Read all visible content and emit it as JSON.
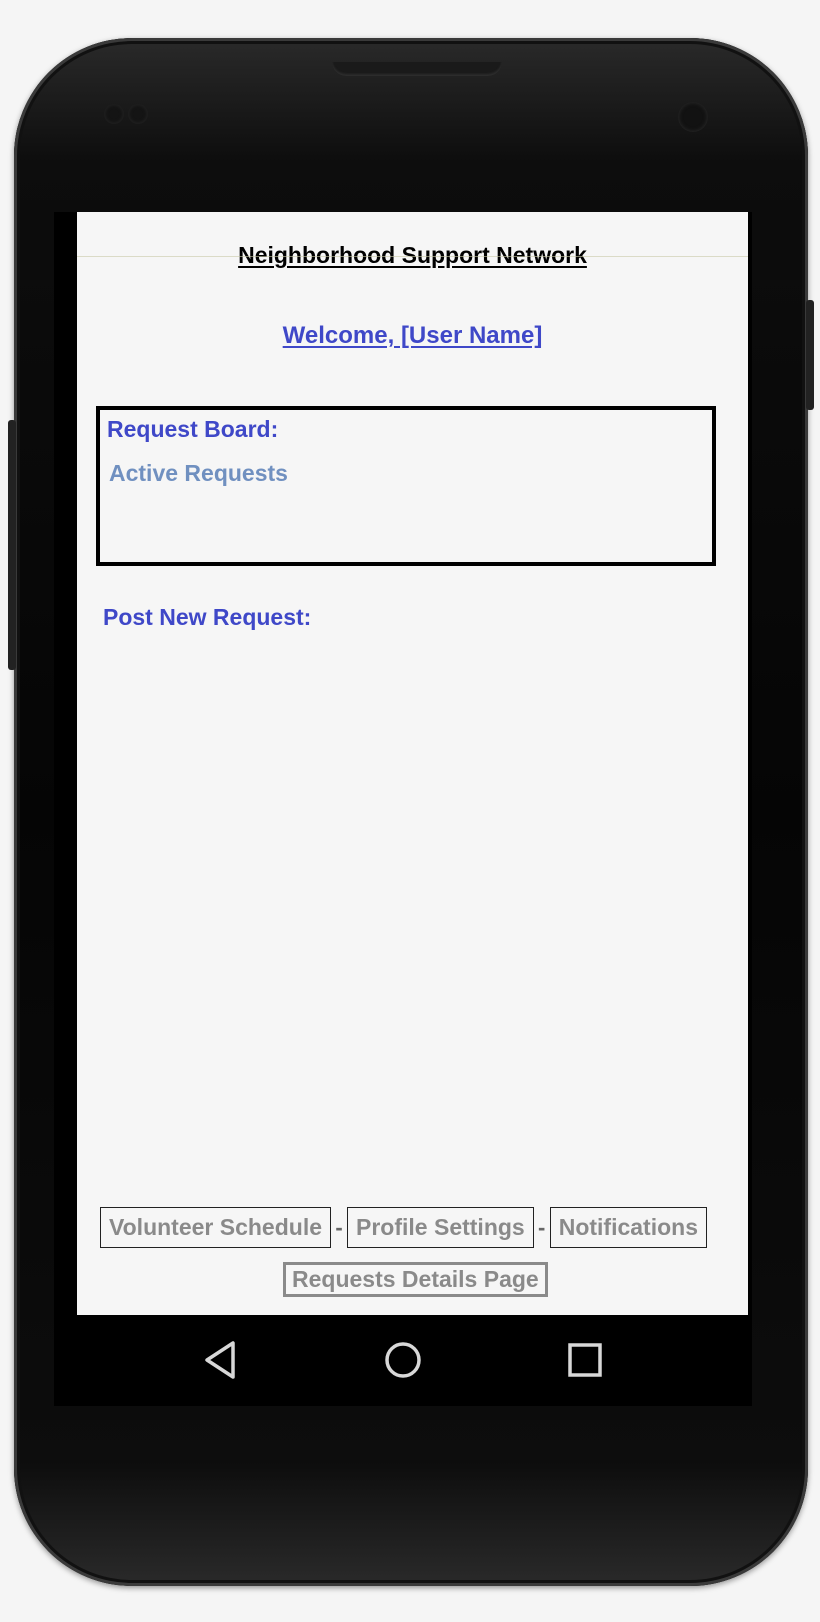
{
  "app": {
    "title": "Neighborhood Support Network",
    "welcome": "Welcome,  [User Name]"
  },
  "request_board": {
    "title": "Request Board:",
    "subtitle": "Active Requests"
  },
  "post_request": {
    "label": "Post New Request:"
  },
  "nav": {
    "items": [
      {
        "label": "Volunteer Schedule"
      },
      {
        "label": "Profile Settings"
      },
      {
        "label": "Notifications"
      }
    ],
    "separator": "-",
    "details_label": "Requests Details Page"
  },
  "system_nav": {
    "back_icon": "back-triangle-icon",
    "home_icon": "home-circle-icon",
    "recents_icon": "recents-square-icon"
  },
  "colors": {
    "accent": "#3f48c8",
    "muted_accent": "#7090c0",
    "nav_text": "#8a8a8a",
    "screen_bg": "#f6f6f6"
  }
}
